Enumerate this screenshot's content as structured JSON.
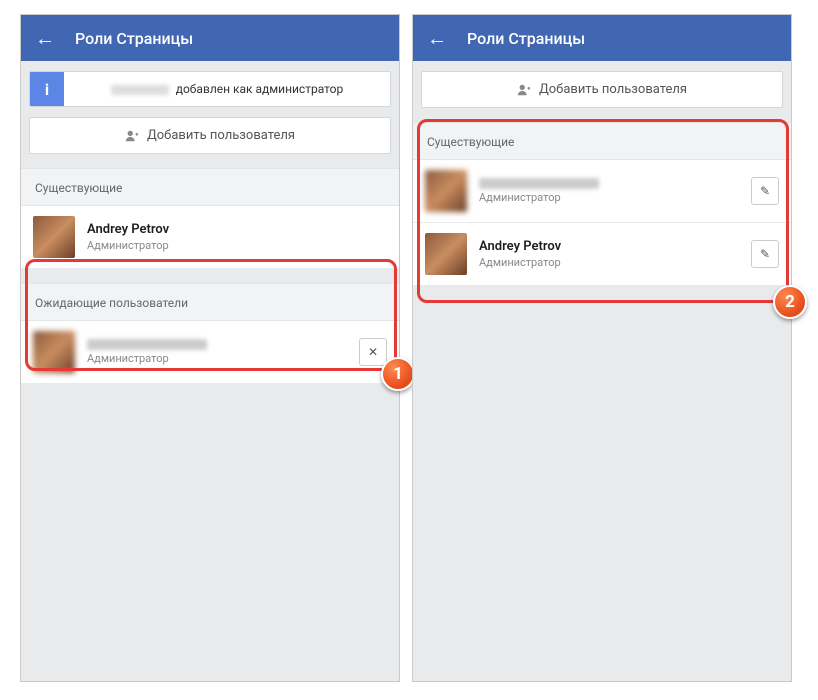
{
  "left": {
    "header": {
      "title": "Роли Страницы"
    },
    "banner": {
      "text": "добавлен как администратор"
    },
    "addButton": {
      "label": "Добавить пользователя"
    },
    "sections": {
      "existing": {
        "title": "Существующие",
        "users": [
          {
            "name": "Andrey Petrov",
            "role": "Администратор",
            "blurred": false
          }
        ]
      },
      "pending": {
        "title": "Ожидающие пользователи",
        "users": [
          {
            "name": "",
            "role": "Администратор",
            "blurred": true,
            "action": "remove"
          }
        ]
      }
    },
    "badge": "1"
  },
  "right": {
    "header": {
      "title": "Роли Страницы"
    },
    "addButton": {
      "label": "Добавить пользователя"
    },
    "sections": {
      "existing": {
        "title": "Существующие",
        "users": [
          {
            "name": "",
            "role": "Администратор",
            "blurred": true,
            "action": "edit"
          },
          {
            "name": "Andrey Petrov",
            "role": "Администратор",
            "blurred": false,
            "action": "edit"
          }
        ]
      }
    },
    "badge": "2"
  }
}
